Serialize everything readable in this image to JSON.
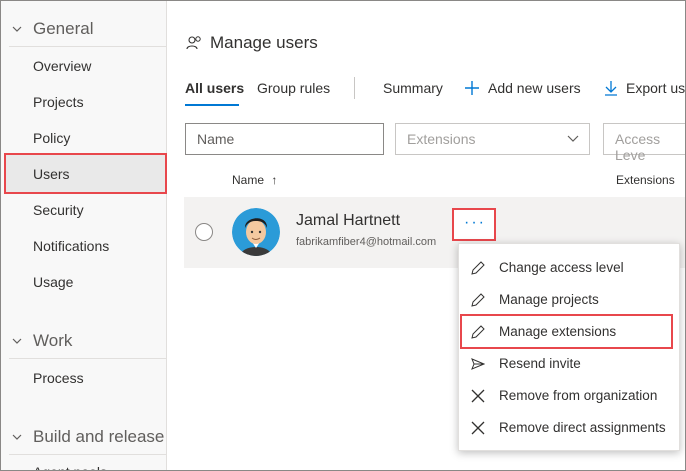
{
  "sidebar": {
    "sections": [
      {
        "label": "General",
        "items": [
          "Overview",
          "Projects",
          "Policy",
          "Users",
          "Security",
          "Notifications",
          "Usage"
        ]
      },
      {
        "label": "Work",
        "items": [
          "Process"
        ]
      },
      {
        "label": "Build and release",
        "items": [
          "Agent pools"
        ]
      }
    ],
    "active_item": "Users"
  },
  "main": {
    "title": "Manage users",
    "tabs": [
      "All users",
      "Group rules"
    ],
    "commands": {
      "summary": "Summary",
      "add": "Add new users",
      "export": "Export us"
    },
    "filters": {
      "name_placeholder": "Name",
      "extensions": "Extensions",
      "access_level": "Access Leve"
    },
    "columns": {
      "name": "Name",
      "sort_arrow": "↑",
      "extensions": "Extensions"
    },
    "user": {
      "name": "Jamal Hartnett",
      "email": "fabrikamfiber4@hotmail.com"
    },
    "more_label": "···"
  },
  "menu": {
    "items": [
      {
        "label": "Change access level",
        "icon": "pencil-icon"
      },
      {
        "label": "Manage projects",
        "icon": "pencil-icon"
      },
      {
        "label": "Manage extensions",
        "icon": "pencil-icon"
      },
      {
        "label": "Resend invite",
        "icon": "send-icon"
      },
      {
        "label": "Remove from organization",
        "icon": "close-icon"
      },
      {
        "label": "Remove direct assignments",
        "icon": "close-icon"
      }
    ],
    "highlighted": "Manage extensions"
  },
  "colors": {
    "accent": "#0078d4",
    "highlight_border": "#e8474c"
  }
}
